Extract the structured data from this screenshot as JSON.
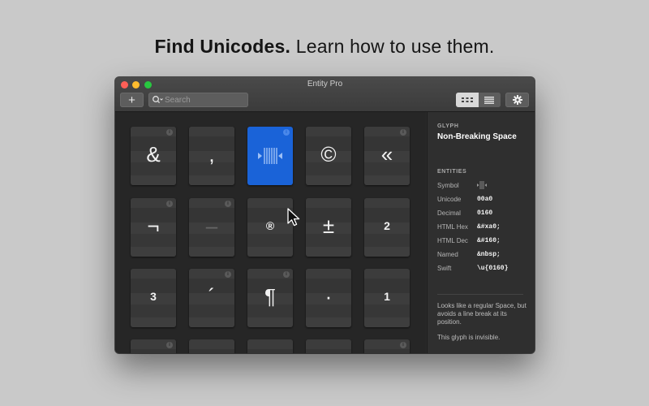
{
  "headline": {
    "bold": "Find Unicodes.",
    "rest": " Learn how to use them."
  },
  "window": {
    "title": "Entity Pro"
  },
  "toolbar": {
    "add_label": "+",
    "search_placeholder": "Search",
    "view_grid_icon": "grid-icon",
    "view_list_icon": "list-icon",
    "settings_icon": "gear-icon"
  },
  "grid": {
    "tiles": [
      {
        "glyph": "&"
      },
      {
        "glyph": ","
      },
      {
        "glyph": ""
      },
      {
        "glyph": "©"
      },
      {
        "glyph": "«"
      },
      {
        "glyph": "¬"
      },
      {
        "glyph": "–"
      },
      {
        "glyph": "®"
      },
      {
        "glyph": "±"
      },
      {
        "glyph": "2"
      },
      {
        "glyph": "3"
      },
      {
        "glyph": "´"
      },
      {
        "glyph": "¶"
      },
      {
        "glyph": "·"
      },
      {
        "glyph": "1"
      }
    ],
    "selected_index": 2
  },
  "panel": {
    "glyph_label": "GLYPH",
    "glyph_name": "Non-Breaking Space",
    "entities_label": "ENTITIES",
    "rows": [
      {
        "key": "Symbol",
        "value": ""
      },
      {
        "key": "Unicode",
        "value": "00a0"
      },
      {
        "key": "Decimal",
        "value": "0160"
      },
      {
        "key": "HTML Hex",
        "value": "&#xa0;"
      },
      {
        "key": "HTML Dec",
        "value": "&#160;"
      },
      {
        "key": "Named",
        "value": "&nbsp;"
      },
      {
        "key": "Swift",
        "value": "\\u{0160}"
      }
    ],
    "description": "Looks like a regular Space, but avoids a line break at its position.",
    "note": "This glyph is invisible."
  },
  "colors": {
    "selected": "#1a63d8",
    "background": "#c9c9c9"
  }
}
